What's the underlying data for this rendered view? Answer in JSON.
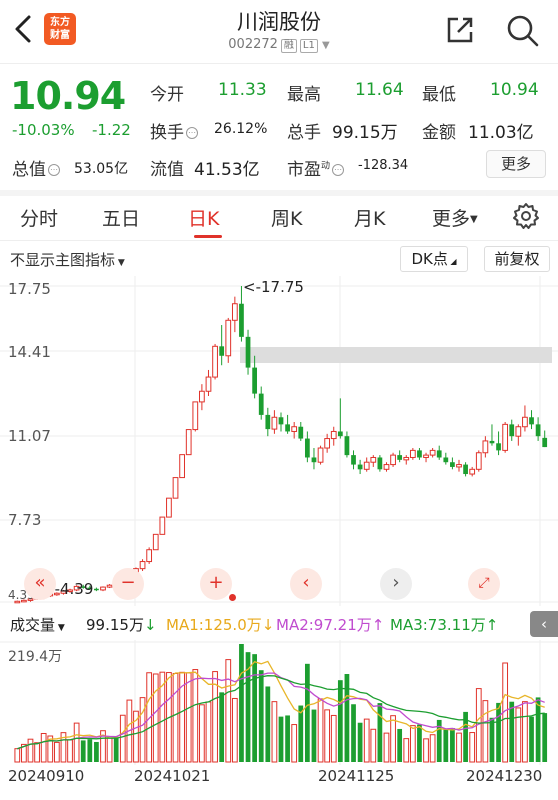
{
  "header": {
    "logo_line1": "东方",
    "logo_line2": "财富",
    "title": "川润股份",
    "code": "002272",
    "tag1": "融",
    "tag2": "L1"
  },
  "quote": {
    "price": "10.94",
    "pct": "-10.03%",
    "change": "-1.22",
    "open_label": "今开",
    "open": "11.33",
    "high_label": "最高",
    "high": "11.64",
    "low_label": "最低",
    "low": "10.94",
    "turnover_label": "换手",
    "turnover": "26.12%",
    "volume_label": "总手",
    "volume": "99.15万",
    "amount_label": "金额",
    "amount": "11.03亿",
    "mktcap_label": "总值",
    "mktcap": "53.05亿",
    "float_label": "流值",
    "float": "41.53亿",
    "pe_label": "市盈",
    "pe_sup": "动",
    "pe": "-128.34",
    "more": "更多"
  },
  "tabs": [
    "分时",
    "五日",
    "日K",
    "周K",
    "月K",
    "更多"
  ],
  "toolbar": {
    "indicator": "不显示主图指标",
    "dk": "DK点",
    "adjust": "前复权"
  },
  "chart_axis": [
    "17.75",
    "14.41",
    "11.07",
    "7.73",
    "4.39"
  ],
  "chart_annotations": {
    "max": "<-17.75",
    "min": "<-4.39"
  },
  "volume": {
    "label": "成交量",
    "value": "99.15万",
    "ma1": "MA1:125.0万",
    "ma2": "MA2:97.21万",
    "ma3": "MA3:73.11万",
    "axis_max": "219.4万"
  },
  "dates": [
    "20240910",
    "20241021",
    "20241125",
    "20241230"
  ],
  "colors": {
    "up": "#e0322a",
    "down": "#1c9e30",
    "ma1": "#e8b62a",
    "ma2": "#c04ccf",
    "ma3": "#1c9e30"
  },
  "chart_data": {
    "type": "candlestick",
    "y_range": [
      4.39,
      17.75
    ],
    "candles": [
      [
        4.4,
        4.45,
        4.35,
        4.42
      ],
      [
        4.42,
        4.5,
        4.38,
        4.46
      ],
      [
        4.46,
        4.55,
        4.4,
        4.52
      ],
      [
        4.52,
        4.6,
        4.48,
        4.58
      ],
      [
        4.58,
        4.7,
        4.5,
        4.65
      ],
      [
        4.65,
        4.78,
        4.6,
        4.72
      ],
      [
        4.72,
        4.8,
        4.65,
        4.76
      ],
      [
        4.76,
        4.9,
        4.7,
        4.85
      ],
      [
        4.85,
        4.95,
        4.78,
        4.9
      ],
      [
        4.9,
        5.1,
        4.85,
        5.05
      ],
      [
        5.05,
        5.12,
        4.95,
        5.0
      ],
      [
        5.0,
        5.08,
        4.9,
        4.95
      ],
      [
        4.95,
        5.0,
        4.85,
        4.9
      ],
      [
        4.9,
        5.05,
        4.85,
        5.02
      ],
      [
        5.02,
        5.15,
        4.98,
        5.1
      ],
      [
        5.1,
        5.2,
        5.0,
        5.05
      ],
      [
        5.05,
        5.3,
        5.0,
        5.25
      ],
      [
        5.25,
        5.6,
        5.2,
        5.55
      ],
      [
        5.55,
        5.85,
        5.5,
        5.8
      ],
      [
        5.8,
        6.2,
        5.7,
        6.1
      ],
      [
        6.1,
        6.7,
        6.0,
        6.6
      ],
      [
        6.6,
        7.25,
        6.6,
        7.25
      ],
      [
        7.25,
        7.98,
        7.25,
        7.98
      ],
      [
        7.98,
        8.78,
        7.98,
        8.78
      ],
      [
        8.78,
        9.65,
        8.78,
        9.65
      ],
      [
        9.65,
        10.62,
        9.65,
        10.62
      ],
      [
        10.62,
        11.68,
        10.62,
        11.68
      ],
      [
        11.68,
        12.85,
        11.6,
        12.85
      ],
      [
        12.85,
        13.6,
        12.5,
        13.3
      ],
      [
        13.3,
        14.2,
        13.1,
        13.9
      ],
      [
        13.9,
        15.3,
        13.8,
        15.2
      ],
      [
        15.2,
        16.1,
        14.4,
        14.8
      ],
      [
        14.8,
        16.4,
        14.5,
        16.3
      ],
      [
        16.3,
        17.3,
        15.8,
        17.0
      ],
      [
        17.0,
        17.75,
        15.4,
        15.6
      ],
      [
        15.6,
        15.9,
        14.0,
        14.3
      ],
      [
        14.3,
        14.8,
        13.0,
        13.2
      ],
      [
        13.2,
        13.5,
        12.1,
        12.3
      ],
      [
        12.3,
        12.6,
        11.4,
        11.7
      ],
      [
        11.7,
        12.5,
        11.5,
        12.2
      ],
      [
        12.2,
        12.4,
        11.6,
        11.9
      ],
      [
        11.9,
        12.3,
        11.5,
        11.6
      ],
      [
        11.6,
        12.0,
        11.3,
        11.8
      ],
      [
        11.8,
        12.0,
        11.2,
        11.3
      ],
      [
        11.3,
        11.6,
        10.3,
        10.5
      ],
      [
        10.5,
        10.9,
        10.0,
        10.3
      ],
      [
        10.3,
        11.0,
        10.2,
        10.9
      ],
      [
        10.9,
        11.5,
        10.7,
        11.3
      ],
      [
        11.3,
        11.8,
        11.0,
        11.6
      ],
      [
        11.6,
        13.0,
        11.3,
        11.4
      ],
      [
        11.4,
        11.6,
        10.5,
        10.6
      ],
      [
        10.6,
        10.8,
        10.0,
        10.2
      ],
      [
        10.2,
        10.4,
        9.8,
        10.0
      ],
      [
        10.0,
        10.5,
        9.9,
        10.3
      ],
      [
        10.3,
        10.6,
        10.1,
        10.5
      ],
      [
        10.5,
        10.6,
        9.9,
        10.0
      ],
      [
        10.0,
        10.3,
        9.9,
        10.2
      ],
      [
        10.2,
        10.7,
        10.1,
        10.6
      ],
      [
        10.6,
        10.8,
        10.3,
        10.4
      ],
      [
        10.4,
        10.6,
        10.2,
        10.5
      ],
      [
        10.5,
        10.9,
        10.4,
        10.8
      ],
      [
        10.8,
        10.9,
        10.4,
        10.5
      ],
      [
        10.5,
        10.7,
        10.3,
        10.6
      ],
      [
        10.6,
        10.9,
        10.5,
        10.8
      ],
      [
        10.8,
        11.0,
        10.4,
        10.5
      ],
      [
        10.5,
        10.7,
        10.2,
        10.3
      ],
      [
        10.3,
        10.5,
        10.0,
        10.1
      ],
      [
        10.1,
        10.4,
        9.9,
        10.2
      ],
      [
        10.2,
        10.3,
        9.7,
        9.8
      ],
      [
        9.8,
        10.1,
        9.7,
        10.0
      ],
      [
        10.0,
        10.8,
        9.9,
        10.7
      ],
      [
        10.7,
        11.4,
        10.5,
        11.2
      ],
      [
        11.2,
        11.9,
        11.0,
        11.1
      ],
      [
        11.1,
        11.6,
        10.6,
        10.8
      ],
      [
        10.8,
        12.0,
        10.7,
        11.9
      ],
      [
        11.9,
        12.1,
        11.2,
        11.4
      ],
      [
        11.4,
        11.9,
        11.0,
        11.8
      ],
      [
        11.8,
        12.7,
        11.6,
        12.2
      ],
      [
        12.2,
        12.5,
        11.7,
        11.9
      ],
      [
        11.9,
        12.2,
        11.2,
        11.4
      ],
      [
        11.33,
        11.64,
        10.94,
        10.94
      ]
    ],
    "volume_max": "219.4万"
  }
}
